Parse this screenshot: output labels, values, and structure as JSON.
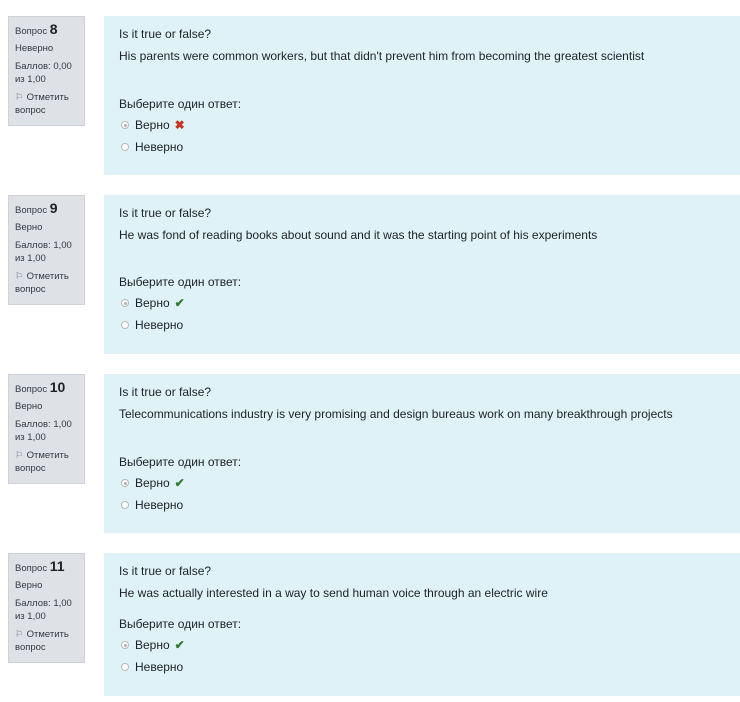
{
  "questions": [
    {
      "label": "Вопрос",
      "number": "8",
      "state": "Неверно",
      "grade": "Баллов: 0,00 из 1,00",
      "flag_label": "Отметить вопрос",
      "text_1": "Is it true or false?",
      "text_2": "His parents were common workers, but that didn't prevent him from becoming the greatest scientist",
      "prompt": "Выберите один ответ:",
      "answers": [
        {
          "label": "Верно",
          "selected": true,
          "mark": "✖"
        },
        {
          "label": "Неверно",
          "selected": false,
          "mark": ""
        }
      ]
    },
    {
      "label": "Вопрос",
      "number": "9",
      "state": "Верно",
      "grade": "Баллов: 1,00 из 1,00",
      "flag_label": "Отметить вопрос",
      "text_1": "Is it true or false?",
      "text_2": "He was fond of reading books about sound and it was the starting point of his experiments",
      "prompt": "Выберите один ответ:",
      "answers": [
        {
          "label": "Верно",
          "selected": true,
          "mark": "✔"
        },
        {
          "label": "Неверно",
          "selected": false,
          "mark": ""
        }
      ]
    },
    {
      "label": "Вопрос",
      "number": "10",
      "state": "Верно",
      "grade": "Баллов: 1,00 из 1,00",
      "flag_label": "Отметить вопрос",
      "text_1": "Is it true or false?",
      "text_2": "Telecommunications industry is very promising and design bureaus work on many breakthrough projects",
      "prompt": "Выберите один ответ:",
      "answers": [
        {
          "label": "Верно",
          "selected": true,
          "mark": "✔"
        },
        {
          "label": "Неверно",
          "selected": false,
          "mark": ""
        }
      ]
    },
    {
      "label": "Вопрос",
      "number": "11",
      "state": "Верно",
      "grade": "Баллов: 1,00 из 1,00",
      "flag_label": "Отметить вопрос",
      "text_1": "Is it true or false?",
      "text_2": "He was actually interested in a way to send human voice through an electric wire",
      "prompt": "Выберите один ответ:",
      "answers": [
        {
          "label": "Верно",
          "selected": true,
          "mark": "✔"
        },
        {
          "label": "Неверно",
          "selected": false,
          "mark": ""
        }
      ]
    }
  ],
  "colors": {
    "content_bg": "#def2f8",
    "info_bg": "#dee2e6",
    "incorrect": "#ca3120",
    "correct": "#357a32"
  }
}
